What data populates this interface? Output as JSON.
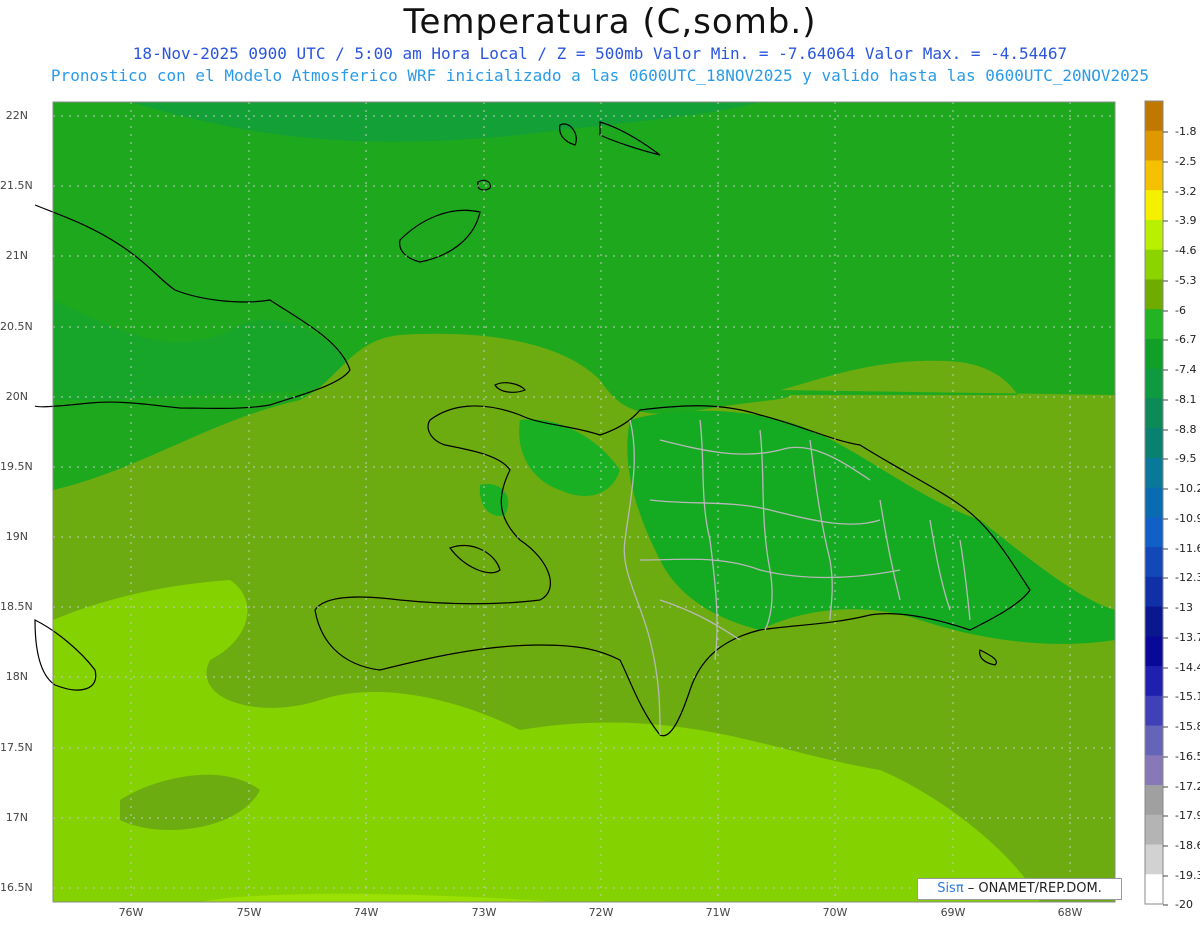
{
  "title": "Temperatura (C,somb.)",
  "subtitle1": "18-Nov-2025  0900 UTC / 5:00 am Hora Local / Z = 500mb  Valor Min. = -7.64064  Valor Max. = -4.54467",
  "subtitle2": "Pronostico con el Modelo Atmosferico WRF inicializado a las 0600UTC_18NOV2025 y valido hasta las  0600UTC_20NOV2025",
  "lat_labels": [
    "22N",
    "21.5N",
    "21N",
    "20.5N",
    "20N",
    "19.5N",
    "19N",
    "18.5N",
    "18N",
    "17.5N",
    "17N",
    "16.5N"
  ],
  "lon_labels": [
    "76W",
    "75W",
    "74W",
    "73W",
    "72W",
    "71W",
    "70W",
    "69W",
    "68W"
  ],
  "colorbar": {
    "labels": [
      "-1.8",
      "-2.5",
      "-3.2",
      "-3.9",
      "-4.6",
      "-5.3",
      "-6",
      "-6.7",
      "-7.4",
      "-8.1",
      "-8.8",
      "-9.5",
      "-10.2",
      "-10.9",
      "-11.6",
      "-12.3",
      "-13",
      "-13.7",
      "-14.4",
      "-15.1",
      "-15.8",
      "-16.5",
      "-17.2",
      "-17.9",
      "-18.6",
      "-19.3",
      "-20"
    ],
    "colors": [
      "#c07800",
      "#e09800",
      "#f5c000",
      "#f5f000",
      "#b8f000",
      "#8cd400",
      "#70ac00",
      "#22b422",
      "#10a028",
      "#0e9a40",
      "#0d8a58",
      "#0a8070",
      "#0a7898",
      "#0a6cb0",
      "#1060c8",
      "#1248b8",
      "#1030a8",
      "#0a1890",
      "#0a0898",
      "#2020b0",
      "#4040b8",
      "#6464b8",
      "#8878b8",
      "#a0a0a0",
      "#b4b4b4",
      "#d2d2d2",
      "#ffffff"
    ]
  },
  "fill_colors": {
    "ocean_north": "#1ea81e",
    "band_mid": "#6cac10",
    "band_south": "#84d200",
    "cooler": "#13a036",
    "land_cool": "#14aa22"
  },
  "credit": {
    "brand": "Sisπ",
    "text": " – ONAMET/REP.DOM."
  }
}
